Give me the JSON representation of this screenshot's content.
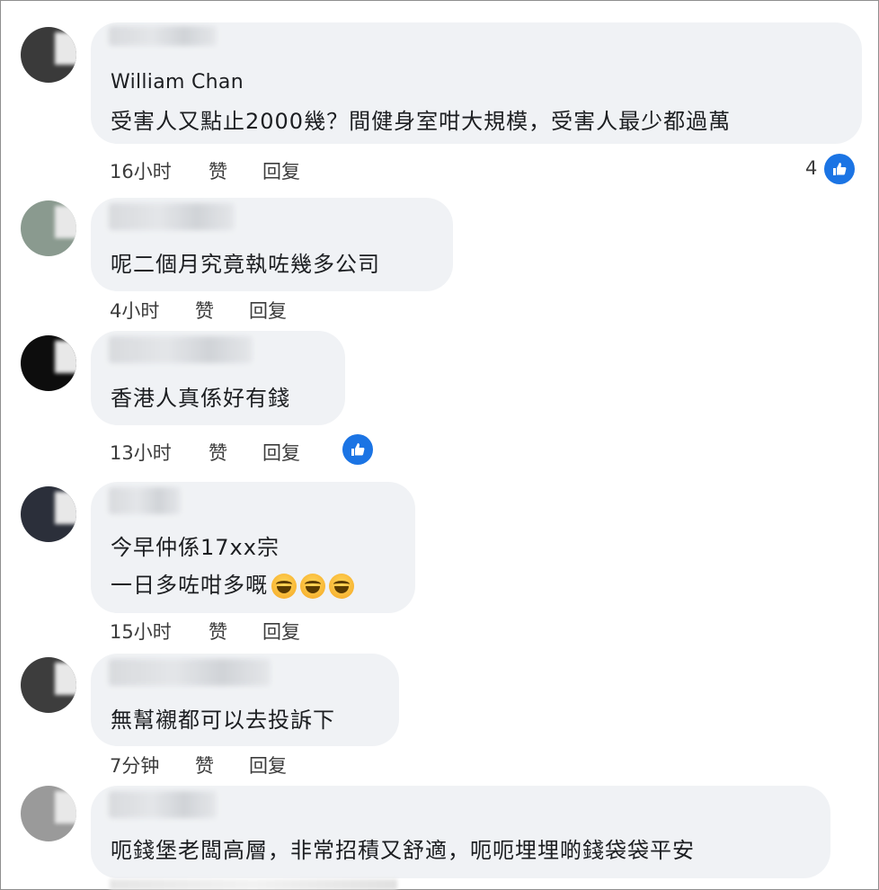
{
  "comments": [
    {
      "name": "William Chan",
      "lines": [
        "受害人又點止2000幾？間健身室咁大規模，受害人最少都過萬"
      ],
      "time": "16小时",
      "like_label": "赞",
      "reply_label": "回复",
      "reactions": "4"
    },
    {
      "name": "",
      "lines": [
        "呢二個月究竟執咗幾多公司"
      ],
      "time": "4小时",
      "like_label": "赞",
      "reply_label": "回复"
    },
    {
      "name": "",
      "lines": [
        "香港人真係好有錢"
      ],
      "time": "13小时",
      "like_label": "赞",
      "reply_label": "回复"
    },
    {
      "name": "",
      "lines": [
        "今早仲係17xx宗",
        "一日多咗咁多嘅"
      ],
      "time": "15小时",
      "like_label": "赞",
      "reply_label": "回复"
    },
    {
      "name": "",
      "lines": [
        "無幫襯都可以去投訴下"
      ],
      "time": "7分钟",
      "like_label": "赞",
      "reply_label": "回复"
    },
    {
      "name": "",
      "lines": [
        "呃錢堡老闆高層，非常招積又舒適，呃呃埋埋啲錢袋袋平安"
      ]
    }
  ],
  "colors": {
    "bubble": "#f0f2f5",
    "like_blue": "#1b74e4",
    "meta_text": "#3c3c3c"
  }
}
